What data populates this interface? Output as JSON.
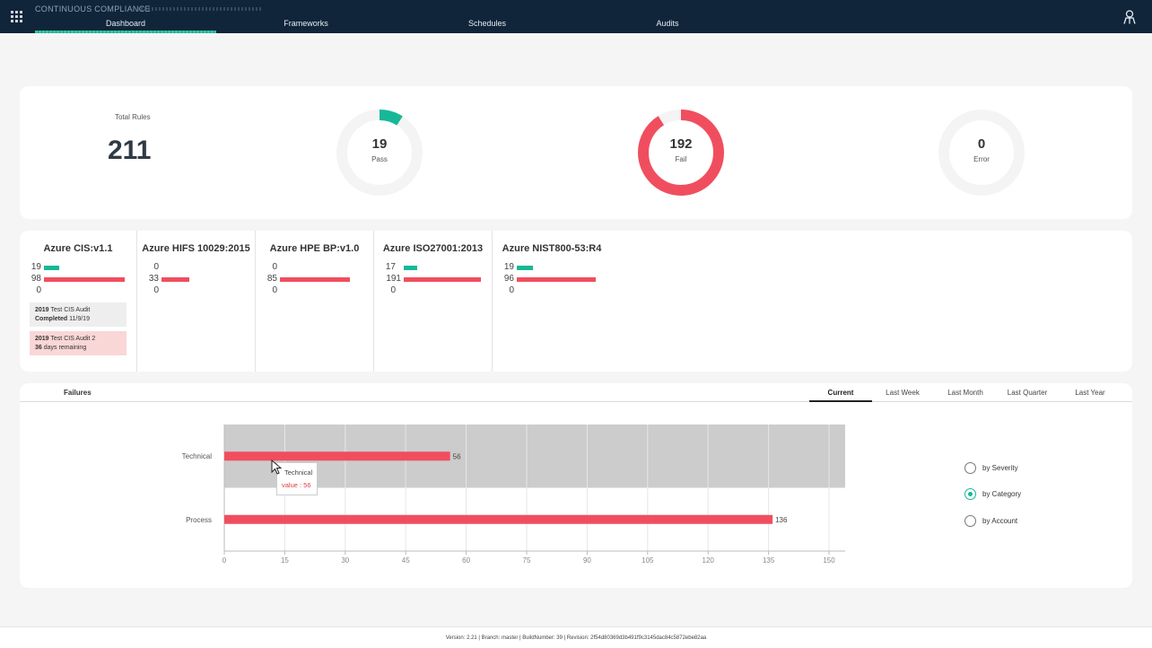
{
  "app": {
    "title": "CONTINUOUS COMPLIANCE"
  },
  "nav": {
    "tabs": [
      "Dashboard",
      "Frameworks",
      "Schedules",
      "Audits"
    ],
    "active": "Dashboard"
  },
  "summary": {
    "total_label": "Total Rules",
    "total_value": "211",
    "pass": {
      "value": "19",
      "label": "Pass",
      "color": "#17b897",
      "fraction": 0.09
    },
    "fail": {
      "value": "192",
      "label": "Fail",
      "color": "#f04e5e",
      "fraction": 0.91
    },
    "error": {
      "value": "0",
      "label": "Error",
      "color": "#cccccc",
      "fraction": 0
    }
  },
  "frameworks": [
    {
      "name": "Azure CIS:v1.1",
      "pass": "19",
      "fail": "98",
      "error": "0"
    },
    {
      "name": "Azure HIFS 10029:2015",
      "pass": "0",
      "fail": "33",
      "error": "0"
    },
    {
      "name": "Azure HPE BP:v1.0",
      "pass": "0",
      "fail": "85",
      "error": "0"
    },
    {
      "name": "Azure ISO27001:2013",
      "pass": "17",
      "fail": "191",
      "error": "0"
    },
    {
      "name": "Azure NIST800-53:R4",
      "pass": "19",
      "fail": "96",
      "error": "0"
    }
  ],
  "audits": [
    {
      "year": "2019",
      "name": "Test CIS Audit",
      "status_bold": "Completed",
      "status": "11/9/19"
    },
    {
      "year": "2019",
      "name": "Test CIS Audit 2",
      "status_bold": "36",
      "status": "days remaining"
    }
  ],
  "failures": {
    "title": "Failures",
    "periods": [
      "Current",
      "Last Week",
      "Last Month",
      "Last Quarter",
      "Last Year"
    ],
    "active_period": "Current",
    "group_options": [
      "by Severity",
      "by Category",
      "by Account"
    ],
    "selected_option": "by Category",
    "tooltip": {
      "title": "Technical",
      "value_text": "value : 56"
    }
  },
  "chart_data": {
    "type": "bar",
    "orientation": "horizontal",
    "categories": [
      "Technical",
      "Process"
    ],
    "values": [
      56,
      136
    ],
    "value_labels": [
      "56",
      "136"
    ],
    "xlim": [
      0,
      154
    ],
    "x_ticks": [
      0,
      15,
      30,
      45,
      60,
      75,
      90,
      105,
      120,
      135,
      150
    ],
    "bar_color": "#f04e5e",
    "highlighted_category": "Technical",
    "grid": true
  },
  "footer": {
    "text": "Version: 2.21 | Branch: master | BuildNumber: 39 | Revision: 2f54d80369d3b491f9c3145dac84c5872ebe82aa"
  }
}
